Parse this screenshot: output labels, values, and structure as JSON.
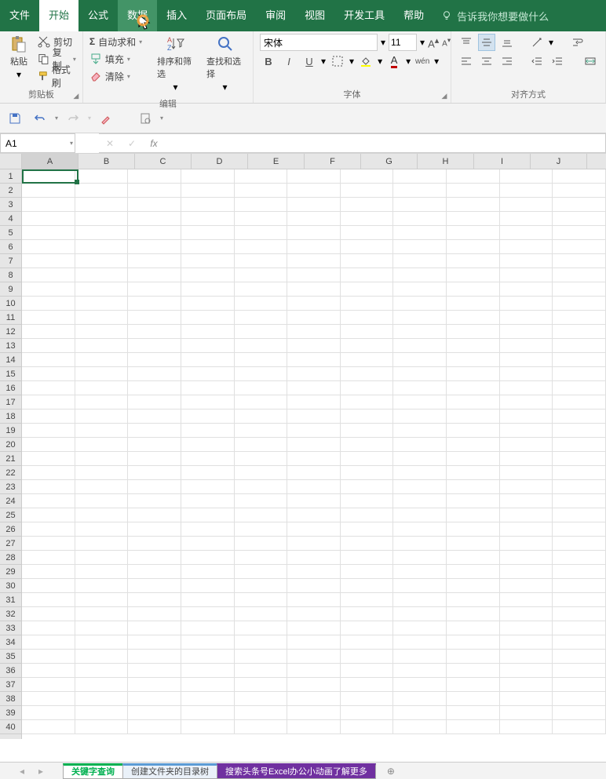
{
  "tabs": {
    "file": "文件",
    "home": "开始",
    "formulas": "公式",
    "data": "数据",
    "insert": "插入",
    "pageLayout": "页面布局",
    "review": "审阅",
    "view": "视图",
    "developer": "开发工具",
    "help": "帮助",
    "tellMe": "告诉我你想要做什么"
  },
  "ribbon": {
    "clipboard": {
      "paste": "粘贴",
      "cut": "剪切",
      "copy": "复制",
      "formatPainter": "格式刷",
      "label": "剪贴板"
    },
    "editing": {
      "autoSum": "自动求和",
      "fill": "填充",
      "clear": "清除",
      "sortFilter": "排序和筛选",
      "findSelect": "查找和选择",
      "label": "编辑"
    },
    "font": {
      "name": "宋体",
      "size": "11",
      "label": "字体"
    },
    "alignment": {
      "label": "对齐方式"
    }
  },
  "nameBox": "A1",
  "formula": "",
  "columns": [
    "A",
    "B",
    "C",
    "D",
    "E",
    "F",
    "G",
    "H",
    "I",
    "J"
  ],
  "rows": 40,
  "sheets": {
    "s1": "关键字查询",
    "s2": "创建文件夹的目录树",
    "s3": "搜索头条号Excel办公小动画了解更多"
  },
  "selectedCell": "A1"
}
